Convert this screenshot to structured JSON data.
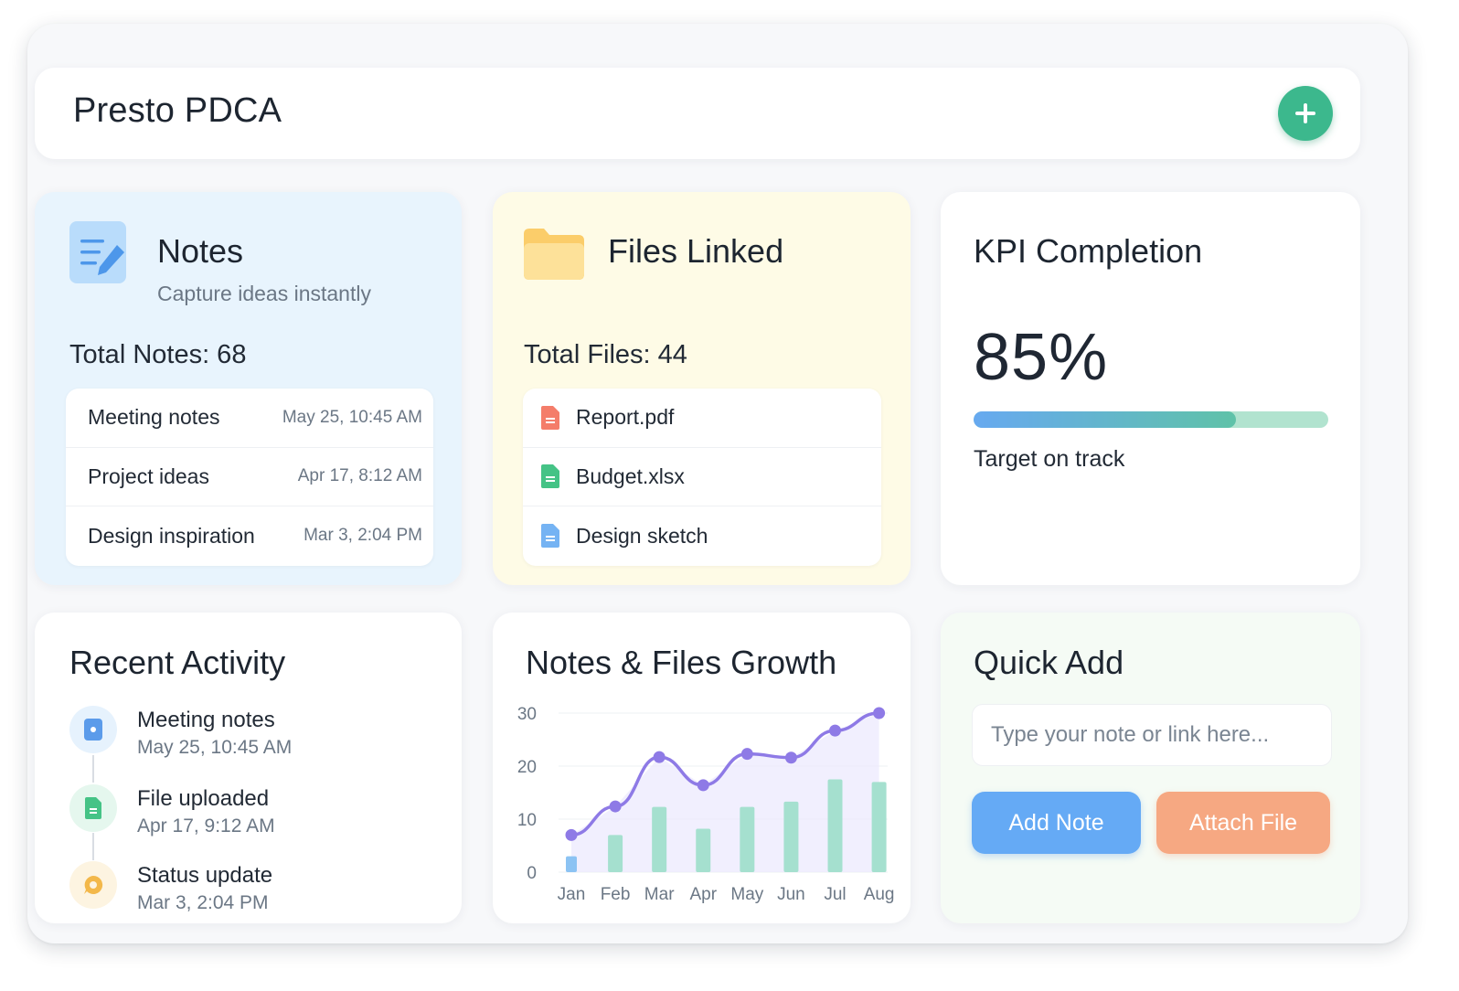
{
  "header": {
    "title": "Presto PDCA",
    "add_icon": "plus-icon"
  },
  "notes": {
    "title": "Notes",
    "subtitle": "Capture ideas instantly",
    "total": "Total Notes: 68",
    "icon": "note-edit-icon",
    "items": [
      {
        "label": "Meeting notes",
        "date": "May 25, 10:45 AM"
      },
      {
        "label": "Project ideas",
        "date": "Apr 17, 8:12 AM"
      },
      {
        "label": "Design inspiration",
        "date": "Mar 3, 2:04 PM"
      }
    ]
  },
  "files": {
    "title": "Files Linked",
    "total": "Total Files: 44",
    "icon": "folder-icon",
    "items": [
      {
        "label": "Report.pdf",
        "color": "#f47d6a"
      },
      {
        "label": "Budget.xlsx",
        "color": "#45c386"
      },
      {
        "label": "Design sketch",
        "color": "#75b3f3"
      }
    ]
  },
  "kpi": {
    "title": "KPI Completion",
    "value": "85%",
    "progress": 0.74,
    "status": "Target on track"
  },
  "activity": {
    "title": "Recent Activity",
    "items": [
      {
        "title": "Meeting notes",
        "date": "May 25, 10:45 AM",
        "icon": "note-icon",
        "color": "#5b9bea",
        "bg": "#e6f2fd"
      },
      {
        "title": "File uploaded",
        "date": "Apr 17, 9:12 AM",
        "icon": "file-icon",
        "color": "#45c386",
        "bg": "#e5f7ee"
      },
      {
        "title": "Status update",
        "date": "Mar 3, 2:04 PM",
        "icon": "status-icon",
        "color": "#f3b84a",
        "bg": "#fdf4e1"
      }
    ]
  },
  "growth": {
    "title": "Notes & Files Growth"
  },
  "quick": {
    "title": "Quick Add",
    "placeholder": "Type your note or link here...",
    "add_note": "Add Note",
    "attach_file": "Attach File"
  },
  "chart_data": {
    "type": "bar",
    "categories": [
      "Jan",
      "Feb",
      "Mar",
      "Apr",
      "May",
      "Jun",
      "Jul",
      "Aug"
    ],
    "series": [
      {
        "type": "bar",
        "values": [
          3,
          7,
          12.3,
          8.2,
          12.3,
          13.3,
          17.5,
          17
        ]
      },
      {
        "type": "line",
        "values": [
          7,
          12.4,
          21.7,
          16.4,
          22.3,
          21.6,
          26.7,
          30
        ]
      }
    ],
    "ylim": [
      0,
      30
    ],
    "yticks": [
      0,
      10,
      20,
      30
    ],
    "colors": {
      "bar": "#a5e0cf",
      "bar_first": "#8cc3f3",
      "line": "#8e7ae6",
      "area": "#eceafd"
    },
    "grid": true
  }
}
